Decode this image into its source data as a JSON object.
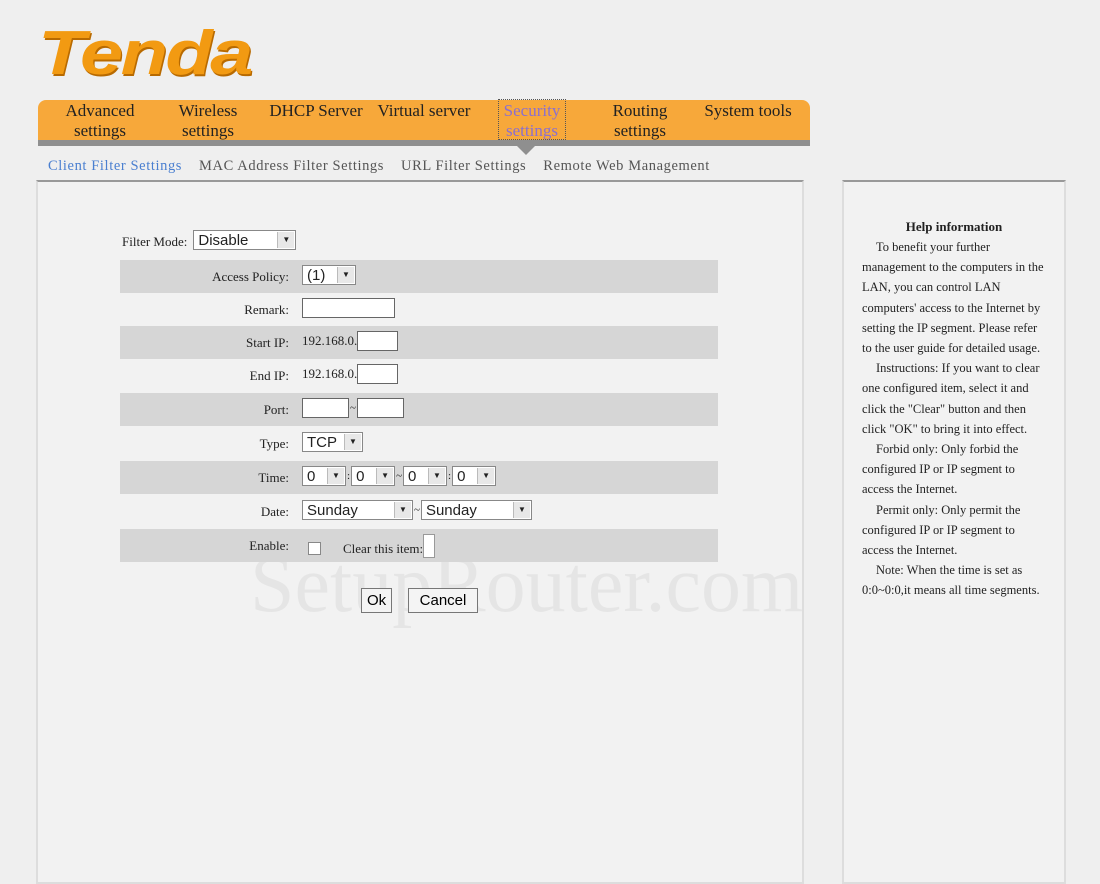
{
  "brand": {
    "logo": "Tenda",
    "color": "#f29a12"
  },
  "nav": {
    "items": [
      "Advanced settings",
      "Wireless settings",
      "DHCP Server",
      "Virtual server",
      "Security settings",
      "Routing settings",
      "System tools"
    ],
    "active": 4,
    "color": "#f7a83a"
  },
  "subnav": {
    "items": [
      "Client Filter Settings",
      "MAC Address Filter Settings",
      "URL Filter Settings",
      "Remote Web Management"
    ],
    "active": 0
  },
  "form": {
    "filter_mode": {
      "label": "Filter Mode:",
      "value": "Disable"
    },
    "access_policy": {
      "label": "Access Policy:",
      "value": "(1)"
    },
    "remark": {
      "label": "Remark:",
      "value": ""
    },
    "start_ip": {
      "label": "Start IP:",
      "prefix": "192.168.0.",
      "value": ""
    },
    "end_ip": {
      "label": "End IP:",
      "prefix": "192.168.0.",
      "value": ""
    },
    "port": {
      "label": "Port:",
      "from": "",
      "to": "",
      "sep": "~"
    },
    "type": {
      "label": "Type:",
      "value": "TCP"
    },
    "time": {
      "label": "Time:",
      "values": [
        "0",
        "0",
        "0",
        "0"
      ],
      "colon": ":",
      "sep": "~"
    },
    "date": {
      "label": "Date:",
      "from": "Sunday",
      "to": "Sunday",
      "sep": "~"
    },
    "enable": {
      "label": "Enable:",
      "checked": false,
      "clear_label": "Clear this item:"
    },
    "ok_label": "Ok",
    "cancel_label": "Cancel"
  },
  "help": {
    "title": "Help information",
    "paragraphs": [
      "To benefit your further management to the computers in the LAN, you can control LAN computers' access to the Internet by setting the IP segment. Please refer to the user guide for detailed usage.",
      "Instructions: If you want to clear one configured item, select it and click the \"Clear\" button and then click \"OK\" to bring it into effect.",
      "Forbid only: Only forbid the configured IP or IP segment to access the Internet.",
      "Permit only: Only permit the configured IP or IP segment to access the Internet.",
      "Note: When the time is set as 0:0~0:0,it means all time segments."
    ]
  },
  "watermark": "SetupRouter.com"
}
